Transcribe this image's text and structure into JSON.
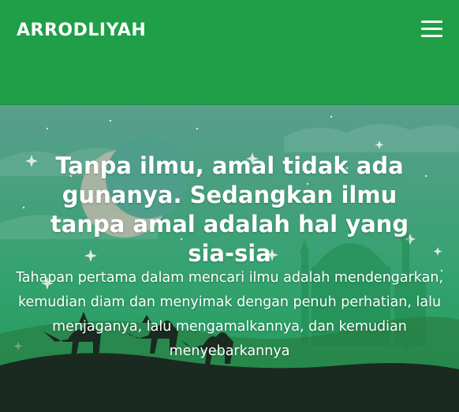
{
  "header": {
    "brand": "ARRODLIYAH",
    "menu_icon": "hamburger-menu-icon"
  },
  "hero": {
    "title": "Tanpa ilmu, amal tidak ada gunanya. Sedangkan ilmu tanpa amal adalah hal yang sia-sia",
    "text": "Tahapan pertama dalam mencari ilmu adalah mendengarkan, kemudian diam dan menyimak dengan penuh perhatian, lalu menjaganya, lalu mengamalkannya, dan kemudian menyebarkannya"
  },
  "colors": {
    "header_bg": "#1f9f47",
    "sky_top": "#4f9e8c",
    "sky_bottom": "#1f9f5b",
    "ground": "#1a2a20"
  }
}
